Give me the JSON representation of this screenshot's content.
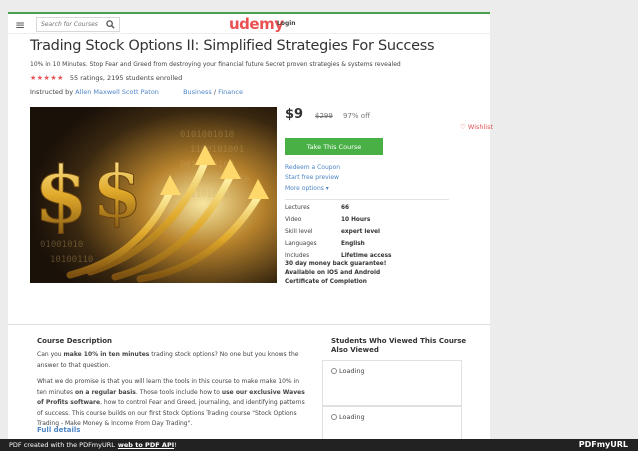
{
  "header": {
    "search_placeholder": "Search for Courses",
    "logo": "udemy",
    "login": "Login"
  },
  "course": {
    "title": "Trading Stock Options II: Simplified Strategies For Success",
    "subtitle": "10% in 10 Minutes. Stop Fear and Greed from destroying your financial future Secret proven strategies & systems revealed",
    "stars": "★★★★★",
    "rating_text": "55 ratings, 2195 students enrolled",
    "instructed_by": "Instructed by",
    "instructor": "Allen Maxwell Scott Paton",
    "category": "Business",
    "category_sep": "/",
    "subcategory": "Finance"
  },
  "purchase": {
    "price": "$9",
    "old_price": "$299",
    "discount": "97% off",
    "wishlist": "Wishlist",
    "take_course": "Take This Course",
    "redeem": "Redeem a Coupon",
    "preview": "Start free preview",
    "more_options": "More options ▾"
  },
  "specs": [
    {
      "label": "Lectures",
      "value": "66"
    },
    {
      "label": "Video",
      "value": "10 Hours"
    },
    {
      "label": "Skill level",
      "value": "expert level"
    },
    {
      "label": "Languages",
      "value": "English"
    },
    {
      "label": "Includes",
      "value": "Lifetime access"
    }
  ],
  "includes_extra": [
    "30 day money back guarantee!",
    "Available on iOS and Android",
    "Certificate of Completion"
  ],
  "description": {
    "title": "Course Description",
    "p1_a": "Can you ",
    "p1_b": "make 10% in ten minutes",
    "p1_c": " trading stock options? No one but you knows the answer to that question.",
    "p2_a": "What we do promise is that you will learn the tools in this course to make make 10% in ten minutes ",
    "p2_b": "on a regular basis",
    "p2_c": ". Those tools include how to ",
    "p2_d": "use our exclusive Waves of Profits software",
    "p2_e": ", how to control Fear and Greed, journaling, and identifying patterns of success. This course builds on our first Stock Options Trading course \"Stock Options Trading - Make Money & Income From Day Trading\".",
    "full_details": "Full details"
  },
  "students": {
    "title": "Students Who Viewed This Course Also Viewed",
    "loading_1": "Loading",
    "loading_2": "Loading"
  },
  "footer": {
    "text": "PDF created with the PDFmyURL",
    "link": "web to PDF API",
    "suffix": "!",
    "logo": "PDFmyURL"
  },
  "colors": {
    "accent_green": "#49b045",
    "brand_red": "#ea5252",
    "link_blue": "#4e86c6"
  }
}
